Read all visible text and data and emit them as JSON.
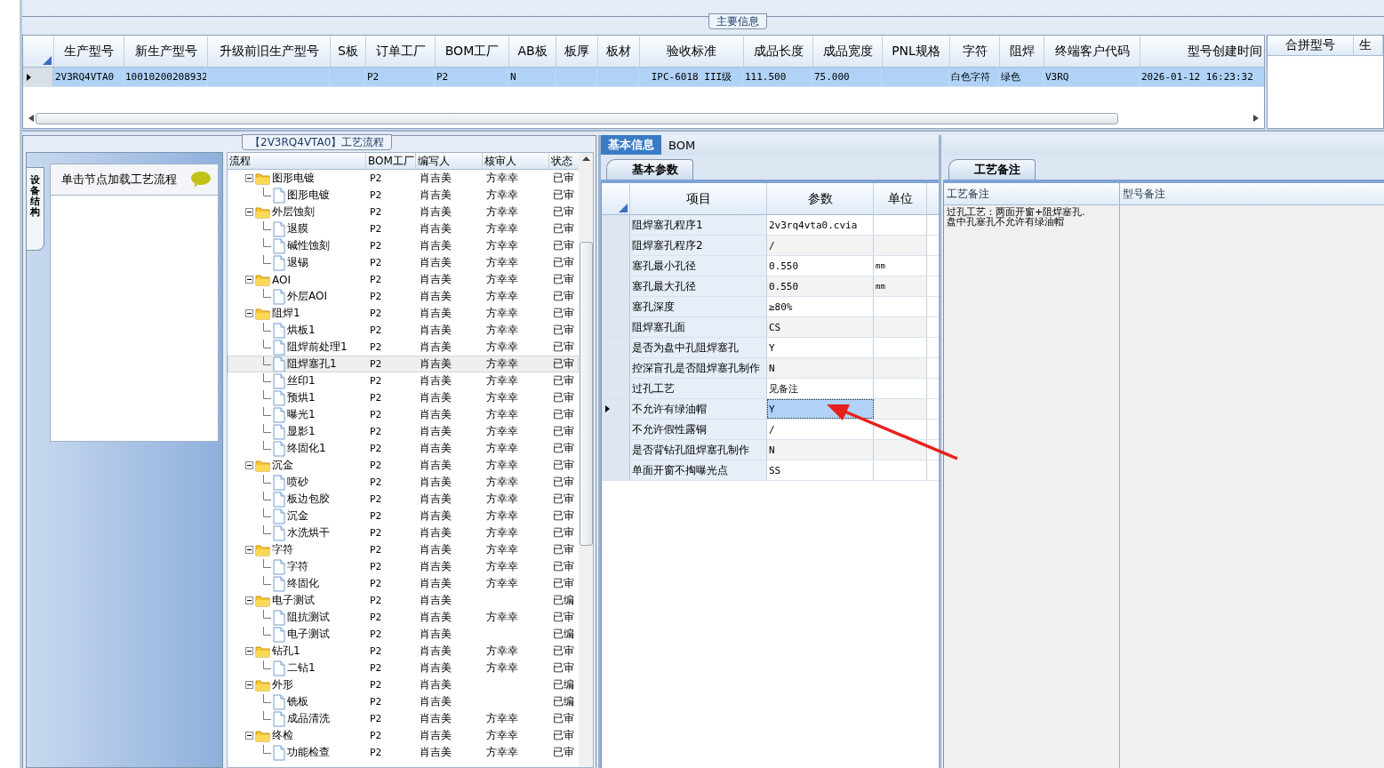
{
  "main_info": {
    "title": "主要信息",
    "table": {
      "columns": [
        "生产型号",
        "新生产型号",
        "升级前旧生产型号",
        "S板",
        "订单工厂",
        "BOM工厂",
        "AB板",
        "板厚",
        "板材",
        "验收标准",
        "成品长度",
        "成品宽度",
        "PNL规格",
        "字符",
        "阻焊",
        "终端客户代码",
        "型号创建时间"
      ],
      "rows": [
        {
          "selected": true,
          "cells": [
            "2V3RQ4VTA0",
            "10010200208932",
            null,
            null,
            "P2",
            "P2",
            "N",
            null,
            null,
            "IPC-6018 III级",
            "111.500",
            "75.000",
            null,
            "白色字符",
            "绿色",
            "V3RQ",
            "2026-01-12 16:23:32"
          ]
        }
      ]
    },
    "merge_table": {
      "columns": [
        "合拼型号",
        "生"
      ]
    }
  },
  "flow_panel": {
    "title": "【2V3RQ4VTA0】工艺流程",
    "side_tab": "设备结构",
    "hint": "单击节点加载工艺流程",
    "columns": [
      "流程",
      "BOM工厂",
      "编写人",
      "核审人",
      "状态"
    ],
    "nodes": [
      {
        "label": "图形电镀",
        "factory": "P2",
        "author": "肖吉美",
        "reviewer": "方幸幸",
        "status": "已审",
        "selected": false,
        "expanded": true,
        "children": [
          {
            "label": "图形电镀",
            "factory": "P2",
            "author": "肖吉美",
            "reviewer": "方幸幸",
            "status": "已审",
            "selected": false
          }
        ]
      },
      {
        "label": "外层蚀刻",
        "factory": "P2",
        "author": "肖吉美",
        "reviewer": "方幸幸",
        "status": "已审",
        "selected": false,
        "expanded": true,
        "children": [
          {
            "label": "退膜",
            "factory": "P2",
            "author": "肖吉美",
            "reviewer": "方幸幸",
            "status": "已审",
            "selected": false
          },
          {
            "label": "碱性蚀刻",
            "factory": "P2",
            "author": "肖吉美",
            "reviewer": "方幸幸",
            "status": "已审",
            "selected": false
          },
          {
            "label": "退锡",
            "factory": "P2",
            "author": "肖吉美",
            "reviewer": "方幸幸",
            "status": "已审",
            "selected": false
          }
        ]
      },
      {
        "label": "AOI",
        "factory": "P2",
        "author": "肖吉美",
        "reviewer": "方幸幸",
        "status": "已审",
        "selected": false,
        "expanded": true,
        "children": [
          {
            "label": "外层AOI",
            "factory": "P2",
            "author": "肖吉美",
            "reviewer": "方幸幸",
            "status": "已审",
            "selected": false
          }
        ]
      },
      {
        "label": "阻焊1",
        "factory": "P2",
        "author": "肖吉美",
        "reviewer": "方幸幸",
        "status": "已审",
        "selected": false,
        "expanded": true,
        "children": [
          {
            "label": "烘板1",
            "factory": "P2",
            "author": "肖吉美",
            "reviewer": "方幸幸",
            "status": "已审",
            "selected": false
          },
          {
            "label": "阻焊前处理1",
            "factory": "P2",
            "author": "肖吉美",
            "reviewer": "方幸幸",
            "status": "已审",
            "selected": false
          },
          {
            "label": "阻焊塞孔1",
            "factory": "P2",
            "author": "肖吉美",
            "reviewer": "方幸幸",
            "status": "已审",
            "selected": true
          },
          {
            "label": "丝印1",
            "factory": "P2",
            "author": "肖吉美",
            "reviewer": "方幸幸",
            "status": "已审",
            "selected": false
          },
          {
            "label": "预烘1",
            "factory": "P2",
            "author": "肖吉美",
            "reviewer": "方幸幸",
            "status": "已审",
            "selected": false
          },
          {
            "label": "曝光1",
            "factory": "P2",
            "author": "肖吉美",
            "reviewer": "方幸幸",
            "status": "已审",
            "selected": false
          },
          {
            "label": "显影1",
            "factory": "P2",
            "author": "肖吉美",
            "reviewer": "方幸幸",
            "status": "已审",
            "selected": false
          },
          {
            "label": "终固化1",
            "factory": "P2",
            "author": "肖吉美",
            "reviewer": "方幸幸",
            "status": "已审",
            "selected": false
          }
        ]
      },
      {
        "label": "沉金",
        "factory": "P2",
        "author": "肖吉美",
        "reviewer": "方幸幸",
        "status": "已审",
        "selected": false,
        "expanded": true,
        "children": [
          {
            "label": "喷砂",
            "factory": "P2",
            "author": "肖吉美",
            "reviewer": "方幸幸",
            "status": "已审",
            "selected": false
          },
          {
            "label": "板边包胶",
            "factory": "P2",
            "author": "肖吉美",
            "reviewer": "方幸幸",
            "status": "已审",
            "selected": false
          },
          {
            "label": "沉金",
            "factory": "P2",
            "author": "肖吉美",
            "reviewer": "方幸幸",
            "status": "已审",
            "selected": false
          },
          {
            "label": "水洗烘干",
            "factory": "P2",
            "author": "肖吉美",
            "reviewer": "方幸幸",
            "status": "已审",
            "selected": false
          }
        ]
      },
      {
        "label": "字符",
        "factory": "P2",
        "author": "肖吉美",
        "reviewer": "方幸幸",
        "status": "已审",
        "selected": false,
        "expanded": true,
        "children": [
          {
            "label": "字符",
            "factory": "P2",
            "author": "肖吉美",
            "reviewer": "方幸幸",
            "status": "已审",
            "selected": false
          },
          {
            "label": "终固化",
            "factory": "P2",
            "author": "肖吉美",
            "reviewer": "方幸幸",
            "status": "已审",
            "selected": false
          }
        ]
      },
      {
        "label": "电子测试",
        "factory": "P2",
        "author": "肖吉美",
        "status": "已编",
        "selected": false,
        "expanded": true,
        "children": [
          {
            "label": "阻抗测试",
            "factory": "P2",
            "author": "肖吉美",
            "reviewer": "方幸幸",
            "status": "已审",
            "selected": false
          },
          {
            "label": "电子测试",
            "factory": "P2",
            "author": "肖吉美",
            "status": "已编",
            "selected": false
          }
        ]
      },
      {
        "label": "钻孔1",
        "factory": "P2",
        "author": "肖吉美",
        "reviewer": "方幸幸",
        "status": "已审",
        "selected": false,
        "expanded": true,
        "children": [
          {
            "label": "二钻1",
            "factory": "P2",
            "author": "肖吉美",
            "reviewer": "方幸幸",
            "status": "已审",
            "selected": false
          }
        ]
      },
      {
        "label": "外形",
        "factory": "P2",
        "author": "肖吉美",
        "status": "已编",
        "selected": false,
        "expanded": true,
        "children": [
          {
            "label": "铣板",
            "factory": "P2",
            "author": "肖吉美",
            "status": "已编",
            "selected": false
          },
          {
            "label": "成品清洗",
            "factory": "P2",
            "author": "肖吉美",
            "reviewer": "方幸幸",
            "status": "已审",
            "selected": false
          }
        ]
      },
      {
        "label": "终检",
        "factory": "P2",
        "author": "肖吉美",
        "reviewer": "方幸幸",
        "status": "已审",
        "selected": false,
        "expanded": true,
        "children": [
          {
            "label": "功能检查",
            "factory": "P2",
            "author": "肖吉美",
            "reviewer": "方幸幸",
            "status": "已审",
            "selected": false
          }
        ]
      }
    ]
  },
  "detail": {
    "tabs": [
      {
        "label": "基本信息",
        "selected": true
      },
      {
        "label": "BOM",
        "selected": false
      }
    ],
    "sub_tab": "基本参数",
    "columns": [
      "项目",
      "参数",
      "单位"
    ],
    "rows": [
      {
        "item": "阻焊塞孔程序1",
        "value": "2v3rq4vta0.cvia",
        "selected": false
      },
      {
        "item": "阻焊塞孔程序2",
        "value": "/",
        "selected": false
      },
      {
        "item": "塞孔最小孔径",
        "value": "0.550",
        "unit": "mm",
        "selected": false
      },
      {
        "item": "塞孔最大孔径",
        "value": "0.550",
        "unit": "mm",
        "selected": false
      },
      {
        "item": "塞孔深度",
        "value": "≥80%",
        "selected": false
      },
      {
        "item": "阻焊塞孔面",
        "value": "CS",
        "selected": false
      },
      {
        "item": "是否为盘中孔阻焊塞孔",
        "value": "Y",
        "selected": false
      },
      {
        "item": "控深盲孔是否阻焊塞孔制作",
        "value": "N",
        "selected": false
      },
      {
        "item": "过孔工艺",
        "value": "见备注",
        "selected": false
      },
      {
        "item": "不允许有绿油帽",
        "value": "Y",
        "selected": true
      },
      {
        "item": "不允许假性露铜",
        "value": "/",
        "selected": false
      },
      {
        "item": "是否背钻孔阻焊塞孔制作",
        "value": "N",
        "selected": false
      },
      {
        "item": "单面开窗不掏曝光点",
        "value": "SS",
        "selected": false
      }
    ]
  },
  "remarks": {
    "tab": "工艺备注",
    "columns": [
      "工艺备注",
      "型号备注"
    ],
    "process_note": "过孔工艺：两面开窗+阻焊塞孔.\n盘中孔塞孔不允许有绿油帽"
  }
}
